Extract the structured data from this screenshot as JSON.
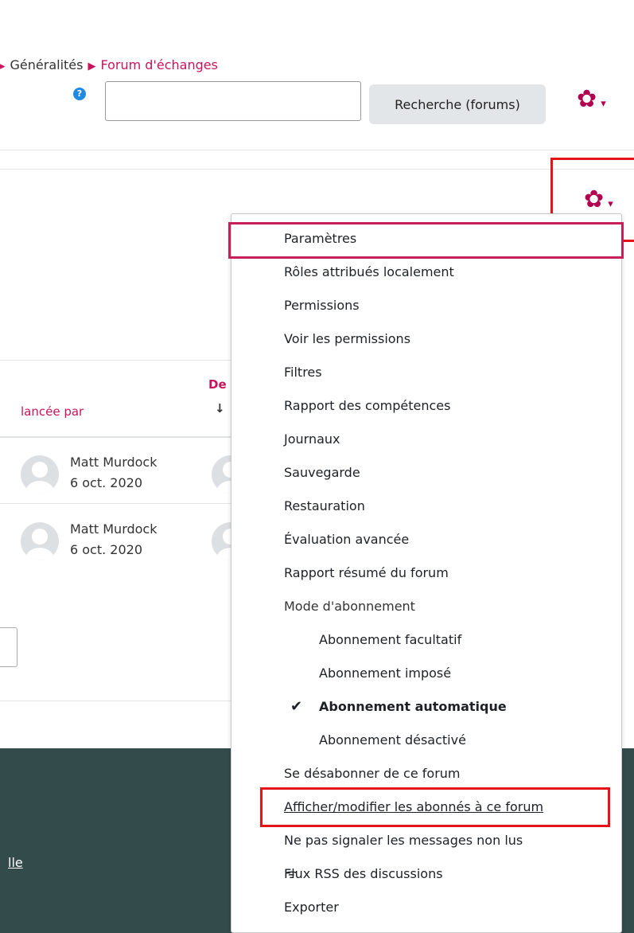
{
  "breadcrumb": {
    "sep_left": "▸",
    "item1": "Généralités",
    "sep": "▶",
    "item2": "Forum d'échanges"
  },
  "search": {
    "value": "",
    "button_label": "Recherche (forums)",
    "help_glyph": "?"
  },
  "header_actions": {
    "gear_glyph": "✿",
    "caret": "▾"
  },
  "table": {
    "col_lancee_par": "lancée par",
    "col_last_prefix": "De",
    "sort_arrow": "↓",
    "rows": [
      {
        "author": "Matt Murdock",
        "date": "6 oct. 2020"
      },
      {
        "author": "Matt Murdock",
        "date": "6 oct. 2020"
      }
    ]
  },
  "footer": {
    "link_fragment": "lle"
  },
  "menu": {
    "items": [
      "Paramètres",
      "Rôles attribués localement",
      "Permissions",
      "Voir les permissions",
      "Filtres",
      "Rapport des compétences",
      "Journaux",
      "Sauvegarde",
      "Restauration",
      "Évaluation avancée",
      "Rapport résumé du forum",
      "Mode d'abonnement"
    ],
    "subscription_modes": [
      "Abonnement facultatif",
      "Abonnement imposé",
      "Abonnement automatique",
      "Abonnement désactivé"
    ],
    "check_glyph": "✔",
    "unsubscribe": "Se désabonner de ce forum",
    "view_subscribers": "Afficher/modifier les abonnés à ce forum",
    "do_not_track": "Ne pas signaler les messages non lus",
    "rss_glyph": "ᯤ",
    "rss": "Flux RSS des discussions",
    "export": "Exporter"
  },
  "colors": {
    "accent": "#b1004f",
    "link": "#c9145d",
    "highlight": "#e5131a",
    "footer": "#344b4b"
  }
}
